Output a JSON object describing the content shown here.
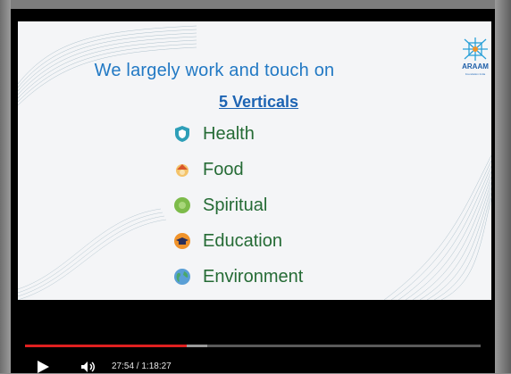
{
  "slide": {
    "headline": "We largely work and touch on",
    "subhead": "5 Verticals",
    "verticals": [
      {
        "label": "Health",
        "icon": "shield-icon",
        "color": "#2e9fb8"
      },
      {
        "label": "Food",
        "icon": "food-icon",
        "color": "#e8a33a"
      },
      {
        "label": "Spiritual",
        "icon": "spiritual-icon",
        "color": "#7dbb4a"
      },
      {
        "label": "Education",
        "icon": "graduation-cap-icon",
        "color": "#f0932b"
      },
      {
        "label": "Environment",
        "icon": "globe-icon",
        "color": "#4aa86b"
      }
    ],
    "logo": {
      "text": "ARAAM",
      "subtext": "Foundation India",
      "color": "#1f5fa8"
    }
  },
  "player": {
    "time_display": "27:54 / 1:18:27",
    "progress_percent": 35.5,
    "buffered_percent": 40,
    "progress_color": "#e02020"
  }
}
